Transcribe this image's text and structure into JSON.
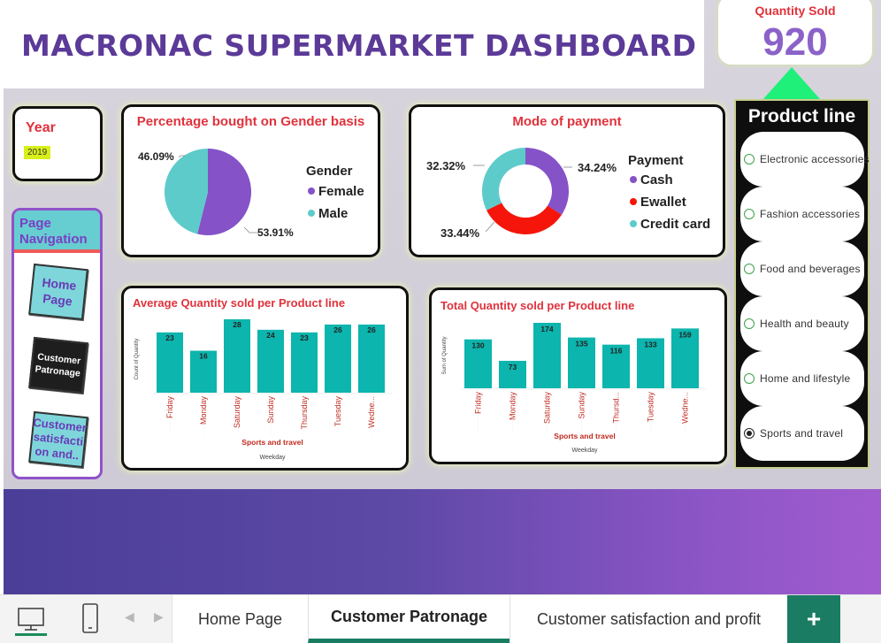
{
  "dashboard": {
    "title": "MACRONAC SUPERMARKET DASHBOARD",
    "quantity_sold": {
      "label": "Quantity Sold",
      "value": "920"
    },
    "year_filter": {
      "label": "Year",
      "value": "2019"
    },
    "page_navigation": {
      "title": "Page Navigation",
      "buttons": [
        "Home Page",
        "Customer Patronage",
        "Customer satisfacti on and.."
      ]
    },
    "product_line": {
      "title": "Product line",
      "items": [
        "Electronic accessories",
        "Fashion accessories",
        "Food and beverages",
        "Health and beauty",
        "Home and lifestyle",
        "Sports and travel"
      ],
      "selected": "Sports and travel"
    },
    "colors": {
      "purple": "#8552c8",
      "teal": "#5ecbcb",
      "red": "#f5150a",
      "bar": "#0cb5ad",
      "title": "#5b3a98"
    }
  },
  "chart_data": [
    {
      "type": "pie",
      "title": "Percentage bought on Gender basis",
      "legend_title": "Gender",
      "legend_position": "right",
      "categories": [
        "Female",
        "Male"
      ],
      "values": [
        53.91,
        46.09
      ],
      "labels": [
        "53.91%",
        "46.09%"
      ]
    },
    {
      "type": "pie",
      "donut": true,
      "title": "Mode of payment",
      "legend_title": "Payment",
      "legend_position": "right",
      "categories": [
        "Cash",
        "Ewallet",
        "Credit card"
      ],
      "values": [
        34.24,
        33.44,
        32.32
      ],
      "labels": [
        "34.24%",
        "33.44%",
        "32.32%"
      ]
    },
    {
      "type": "bar",
      "title": "Average Quantity sold per Product line",
      "subtitle": "Sports and travel",
      "xlabel": "Weekday",
      "ylabel": "Count of Quantity",
      "categories": [
        "Friday",
        "Monday",
        "Saturday",
        "Sunday",
        "Thursday",
        "Tuesday",
        "Wedne..."
      ],
      "values": [
        23,
        16,
        28,
        24,
        23,
        26,
        26
      ],
      "ylim": [
        0,
        28
      ]
    },
    {
      "type": "bar",
      "title": "Total Quantity sold per Product line",
      "subtitle": "Sports and travel",
      "xlabel": "Weekday",
      "ylabel": "Sum of Quantity",
      "categories": [
        "Friday",
        "Monday",
        "Saturday",
        "Sunday",
        "Thursd...",
        "Tuesday",
        "Wedne..."
      ],
      "values": [
        130,
        73,
        174,
        135,
        116,
        133,
        159
      ],
      "ylim": [
        0,
        174
      ]
    }
  ],
  "tabs": {
    "pages": [
      "Home Page",
      "Customer Patronage",
      "Customer satisfaction and profit"
    ],
    "active": "Customer Patronage",
    "add_label": "+"
  }
}
